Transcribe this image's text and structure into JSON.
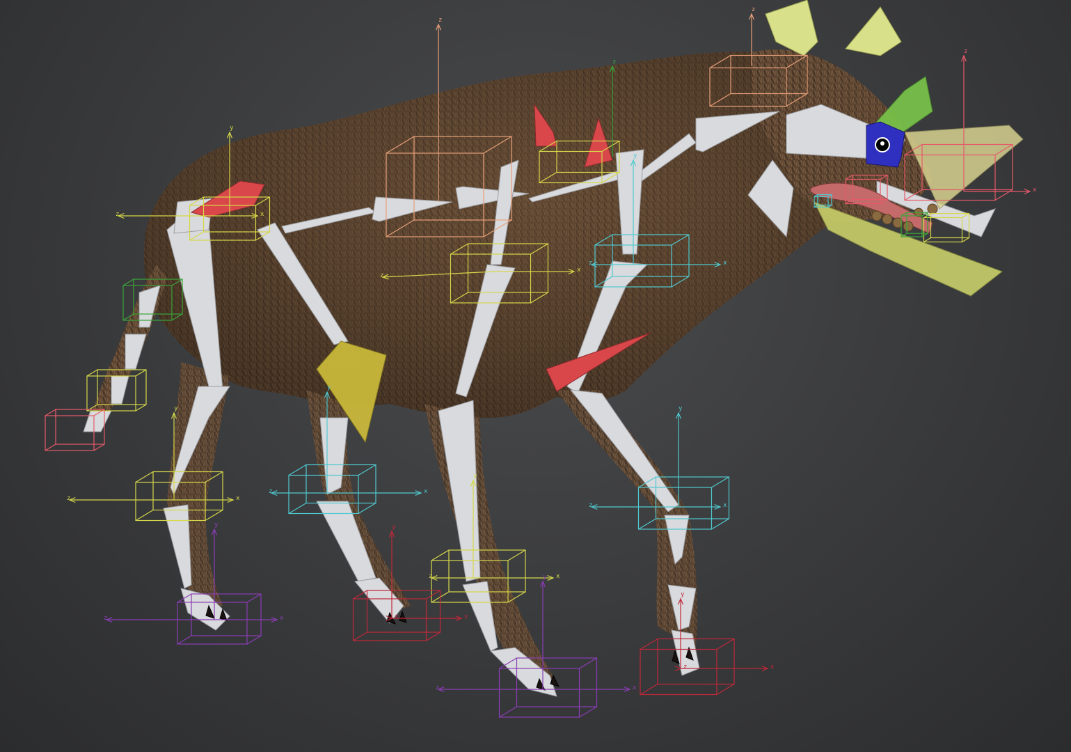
{
  "viewport": {
    "title": "",
    "background_top": "#4a4b4d",
    "background_bottom": "#2b2c2e"
  },
  "scene": {
    "model": "hyena-rig",
    "fur_color": "#5a4330",
    "bone_color": "#d9dadd",
    "axis_labels": {
      "x": "x",
      "y": "y",
      "z": "z"
    },
    "helper_colors": {
      "yellow": "#d6d84a",
      "cyan": "#4fc9d0",
      "purple": "#8a3db5",
      "red": "#c0283a",
      "green": "#3aa53a",
      "salmon": "#e8a07a",
      "pink": "#e65a6a"
    },
    "control_colors": {
      "red_cone": "#d9474a",
      "yellow_wedge": "#c9b83a",
      "light_yellow": "#d8e08a",
      "green_plane": "#7ac64a",
      "blue_eye": "#3030c0",
      "tongue": "#c46a6a"
    }
  }
}
